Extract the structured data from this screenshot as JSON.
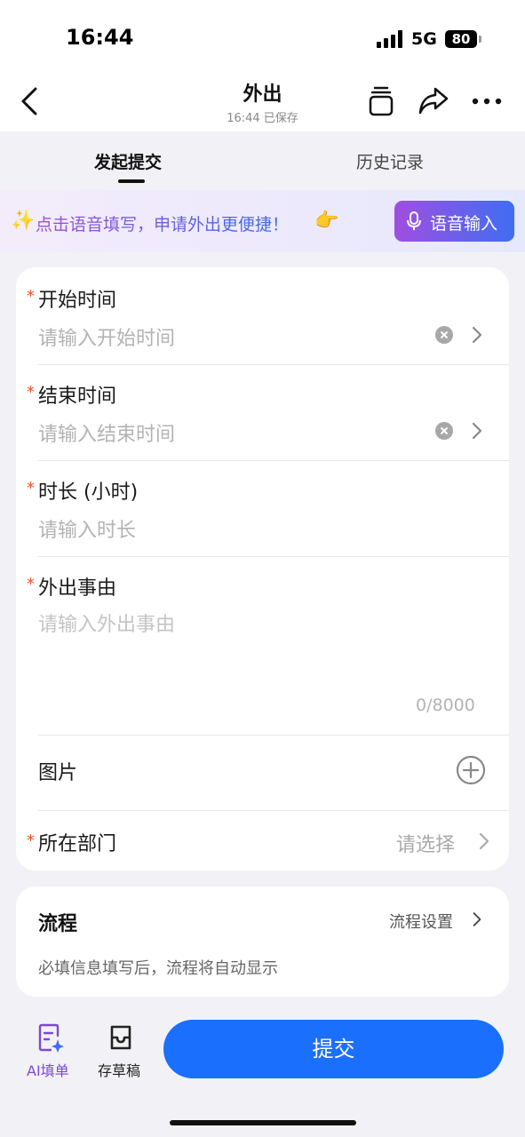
{
  "status_bar": {
    "time": "16:44",
    "network": "5G",
    "battery": "80"
  },
  "nav": {
    "title": "外出",
    "subtitle": "16:44 已保存"
  },
  "tabs": [
    {
      "label": "发起提交",
      "active": true
    },
    {
      "label": "历史记录",
      "active": false
    }
  ],
  "banner": {
    "text": "点击语音填写，申请外出更便捷！",
    "voice_button": "语音输入"
  },
  "form": {
    "required_mark": "*",
    "start_time": {
      "label": "开始时间",
      "placeholder": "请输入开始时间"
    },
    "end_time": {
      "label": "结束时间",
      "placeholder": "请输入结束时间"
    },
    "duration": {
      "label": "时长 (小时)",
      "placeholder": "请输入时长"
    },
    "reason": {
      "label": "外出事由",
      "placeholder": "请输入外出事由",
      "counter": "0/8000"
    },
    "images": {
      "label": "图片"
    },
    "department": {
      "label": "所在部门",
      "placeholder": "请选择"
    }
  },
  "flow": {
    "title": "流程",
    "settings_label": "流程设置",
    "hint": "必填信息填写后，流程将自动显示"
  },
  "bottom": {
    "ai_fill": "AI填单",
    "save_draft": "存草稿",
    "submit": "提交"
  },
  "colors": {
    "accent": "#1a6ffc",
    "required": "#e8532e",
    "ai": "#7b48d8"
  }
}
